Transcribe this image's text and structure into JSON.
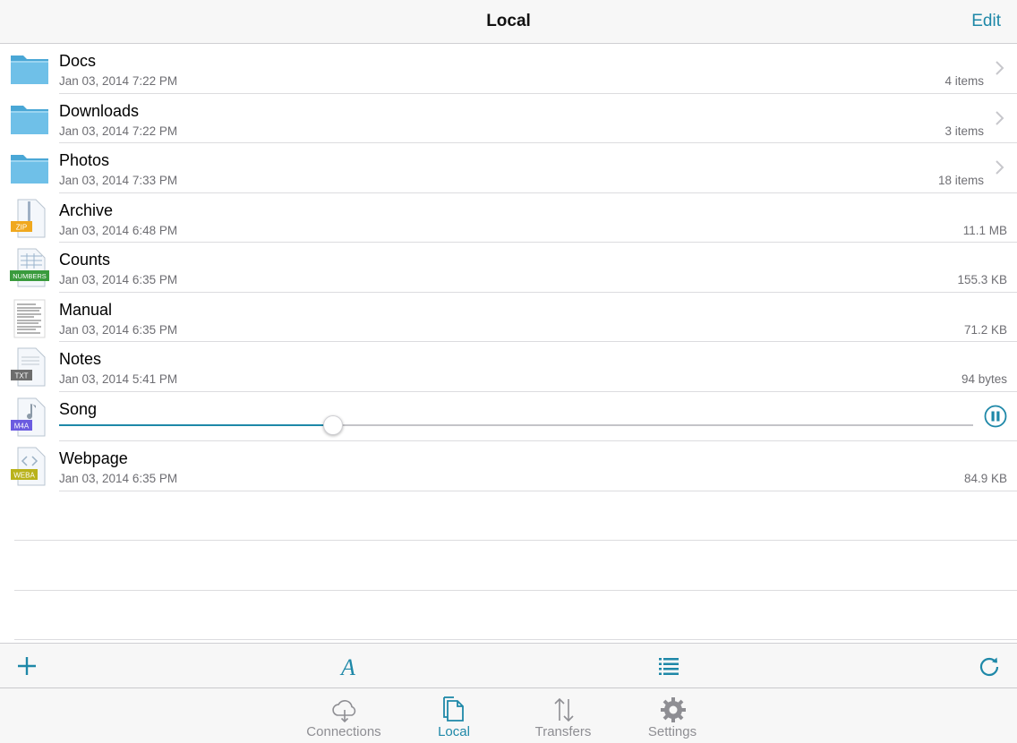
{
  "colors": {
    "accent": "#1e88a8",
    "inactive": "#8e8e93",
    "folder": "#5eb6e0"
  },
  "navbar": {
    "title": "Local",
    "edit_label": "Edit"
  },
  "files": [
    {
      "name": "Docs",
      "date": "Jan 03, 2014 7:22 PM",
      "meta": "4 items",
      "kind": "folder",
      "icon": "folder-icon"
    },
    {
      "name": "Downloads",
      "date": "Jan 03, 2014 7:22 PM",
      "meta": "3 items",
      "kind": "folder",
      "icon": "folder-icon"
    },
    {
      "name": "Photos",
      "date": "Jan 03, 2014 7:33 PM",
      "meta": "18 items",
      "kind": "folder",
      "icon": "folder-icon"
    },
    {
      "name": "Archive",
      "date": "Jan 03, 2014 6:48 PM",
      "meta": "11.1 MB",
      "kind": "file",
      "icon": "zip-file-icon",
      "badge": "ZIP"
    },
    {
      "name": "Counts",
      "date": "Jan 03, 2014 6:35 PM",
      "meta": "155.3 KB",
      "kind": "file",
      "icon": "numbers-file-icon",
      "badge": "NUMBERS"
    },
    {
      "name": "Manual",
      "date": "Jan 03, 2014 6:35 PM",
      "meta": "71.2 KB",
      "kind": "file",
      "icon": "document-file-icon"
    },
    {
      "name": "Notes",
      "date": "Jan 03, 2014 5:41 PM",
      "meta": "94 bytes",
      "kind": "file",
      "icon": "txt-file-icon",
      "badge": "TXT"
    },
    {
      "name": "Song",
      "kind": "playing",
      "icon": "m4a-file-icon",
      "badge": "M4A",
      "progress": 0.3
    },
    {
      "name": "Webpage",
      "date": "Jan 03, 2014 6:35 PM",
      "meta": "84.9 KB",
      "kind": "file",
      "icon": "weba-file-icon",
      "badge": "WEBA"
    }
  ],
  "toolbar": [
    {
      "icon": "plus-icon"
    },
    {
      "icon": "font-icon"
    },
    {
      "icon": "list-icon"
    },
    {
      "icon": "refresh-icon"
    }
  ],
  "tabs": [
    {
      "label": "Connections",
      "icon": "cloud-icon",
      "active": false
    },
    {
      "label": "Local",
      "icon": "local-files-icon",
      "active": true
    },
    {
      "label": "Transfers",
      "icon": "transfer-arrows-icon",
      "active": false
    },
    {
      "label": "Settings",
      "icon": "gear-icon",
      "active": false
    }
  ]
}
